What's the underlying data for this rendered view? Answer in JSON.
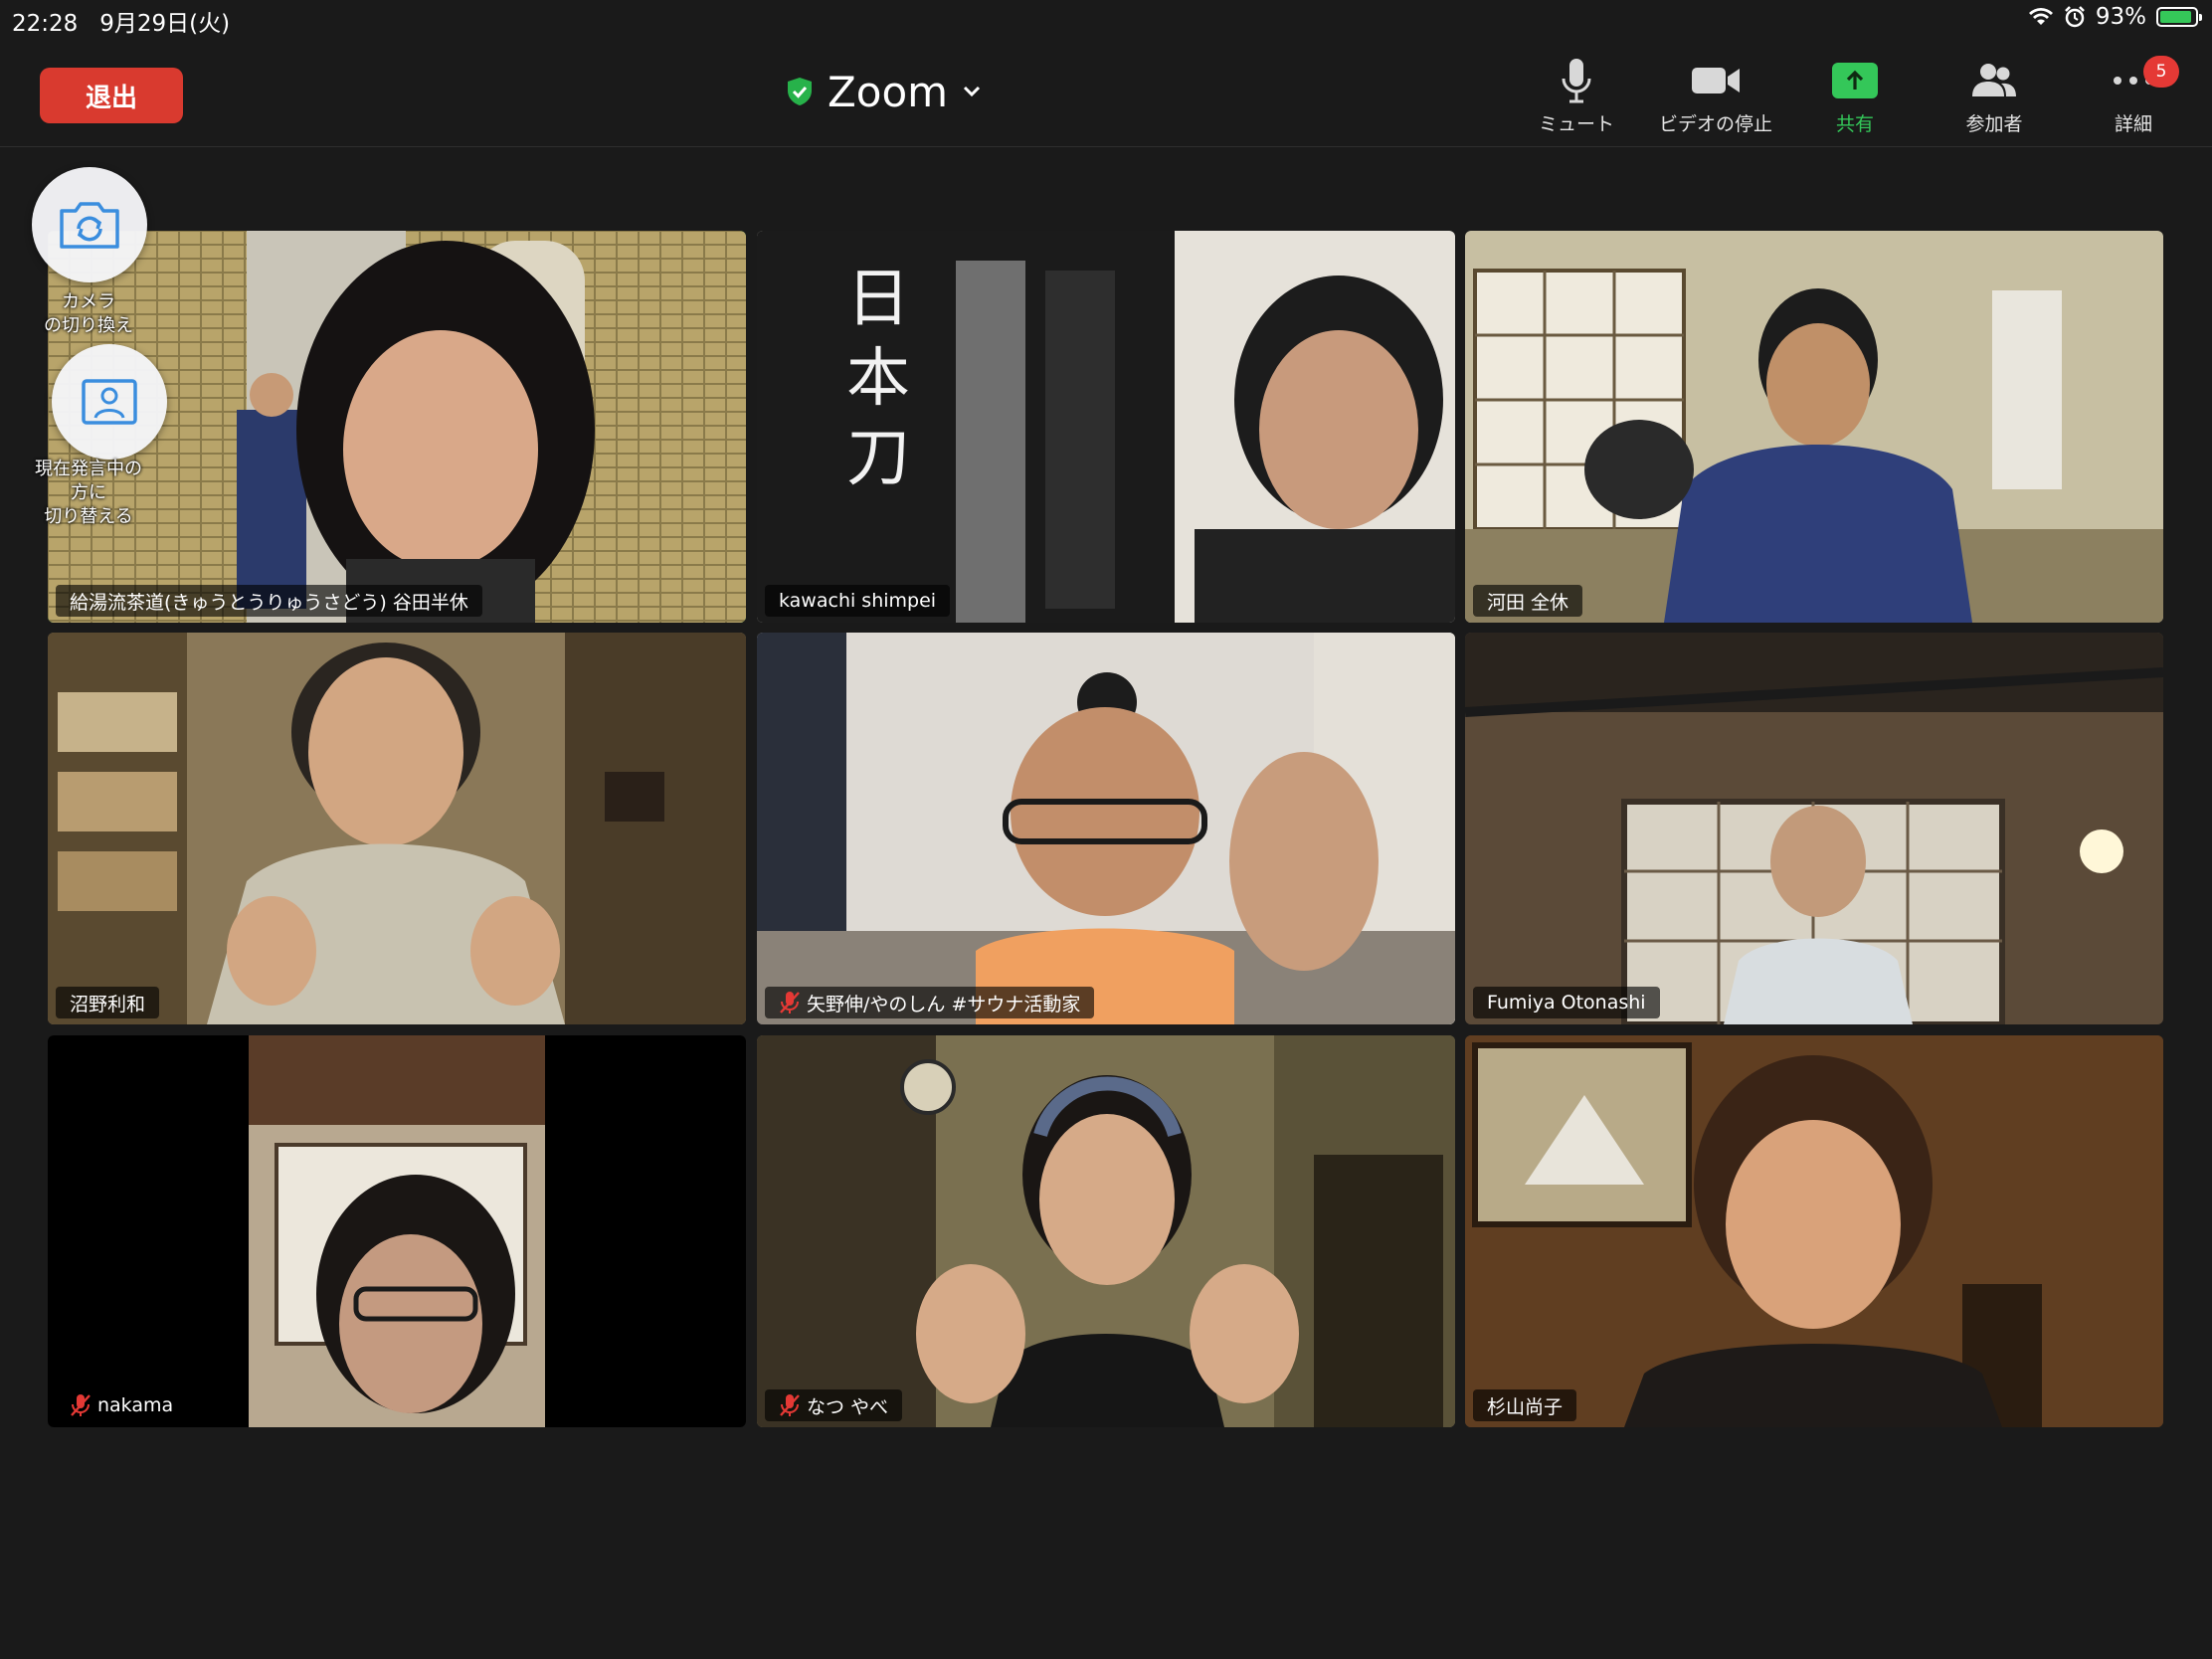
{
  "status_bar": {
    "time": "22:28",
    "date": "9月29日(火)",
    "battery": "93%",
    "battery_level": 0.93,
    "icons": [
      "wifi-icon",
      "alarm-icon",
      "battery-charging-icon"
    ]
  },
  "toolbar": {
    "leave_label": "退出",
    "meeting_title": "Zoom",
    "mute_label": "ミュート",
    "video_label": "ビデオの停止",
    "share_label": "共有",
    "participants_label": "参加者",
    "more_label": "詳細",
    "more_badge": "5"
  },
  "floating": {
    "switch_camera_label": "カメラ\nの切り換え",
    "switch_speaker_label": "現在発言中の\n方に\n切り替える"
  },
  "participants": [
    {
      "name": "給湯流茶道(きゅうとうりゅうさどう) 谷田半休",
      "muted": false,
      "active": true
    },
    {
      "name": "kawachi shimpei",
      "muted": false,
      "active": false
    },
    {
      "name": "河田 全休",
      "muted": false,
      "active": false
    },
    {
      "name": "沼野利和",
      "muted": false,
      "active": false
    },
    {
      "name": "矢野伸/やのしん #サウナ活動家",
      "muted": true,
      "active": false
    },
    {
      "name": "Fumiya Otonashi",
      "muted": false,
      "active": false
    },
    {
      "name": "nakama",
      "muted": true,
      "active": false
    },
    {
      "name": "なつ やべ",
      "muted": true,
      "active": false
    },
    {
      "name": "杉山尚子",
      "muted": false,
      "active": false
    }
  ],
  "colors": {
    "background": "#1a1a1a",
    "leave": "#d93a2f",
    "active_speaker": "#3dd35b",
    "share": "#34c759",
    "badge": "#e53935",
    "muted_icon": "#e53935"
  }
}
